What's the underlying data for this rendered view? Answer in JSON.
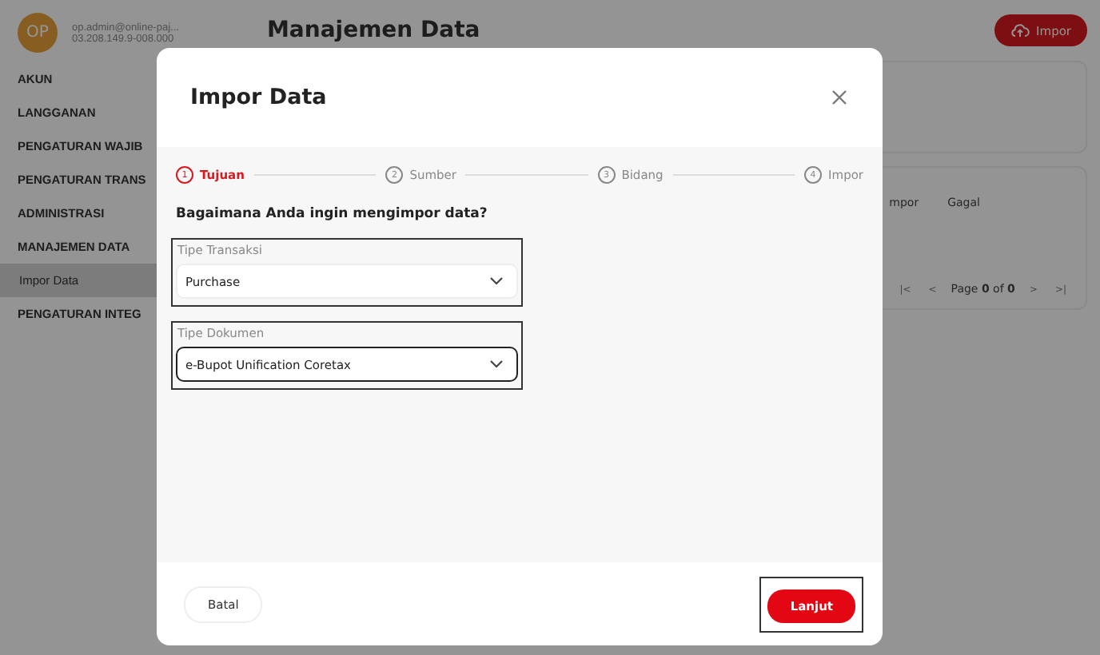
{
  "user": {
    "initials": "OP",
    "email": "op.admin@online-paj...",
    "npwp": "03.208.149.9-008.000"
  },
  "sidebar": {
    "items": [
      {
        "label": "AKUN",
        "kind": "section",
        "selected": false
      },
      {
        "label": "LANGGANAN",
        "kind": "section",
        "selected": false
      },
      {
        "label": "PENGATURAN WAJIB",
        "kind": "section",
        "selected": false
      },
      {
        "label": "PENGATURAN TRANS",
        "kind": "section",
        "selected": false
      },
      {
        "label": "ADMINISTRASI",
        "kind": "section",
        "selected": false
      },
      {
        "label": "MANAJEMEN DATA",
        "kind": "section",
        "selected": false
      },
      {
        "label": "Impor Data",
        "kind": "item",
        "selected": true
      },
      {
        "label": "PENGATURAN INTEG",
        "kind": "section",
        "selected": false
      }
    ]
  },
  "page": {
    "title": "Manajemen Data",
    "import_button": "Impor"
  },
  "table": {
    "columns": [
      "mpor",
      "Gagal"
    ],
    "pagination": {
      "first": "|<",
      "prev": "<",
      "text": "Page **0** of **0**",
      "next": ">",
      "last": ">|"
    }
  },
  "dialog": {
    "title": "Impor Data",
    "steps": [
      {
        "number": "1",
        "label": "Tujuan",
        "selected": true
      },
      {
        "number": "2",
        "label": "Sumber",
        "selected": false
      },
      {
        "number": "3",
        "label": "Bidang",
        "selected": false
      },
      {
        "number": "4",
        "label": "Impor",
        "selected": false
      }
    ],
    "question": "Bagaimana Anda ingin mengimpor data?",
    "fields": [
      {
        "label": "Tipe Transaksi",
        "value": "Purchase",
        "focused": false,
        "outlined": true
      },
      {
        "label": "Tipe Dokumen",
        "value": "e-Bupot Unification Coretax",
        "focused": true,
        "outlined": true
      }
    ],
    "cancel_button": "Batal",
    "next_button": {
      "label": "Lanjut",
      "outlined": true
    }
  }
}
